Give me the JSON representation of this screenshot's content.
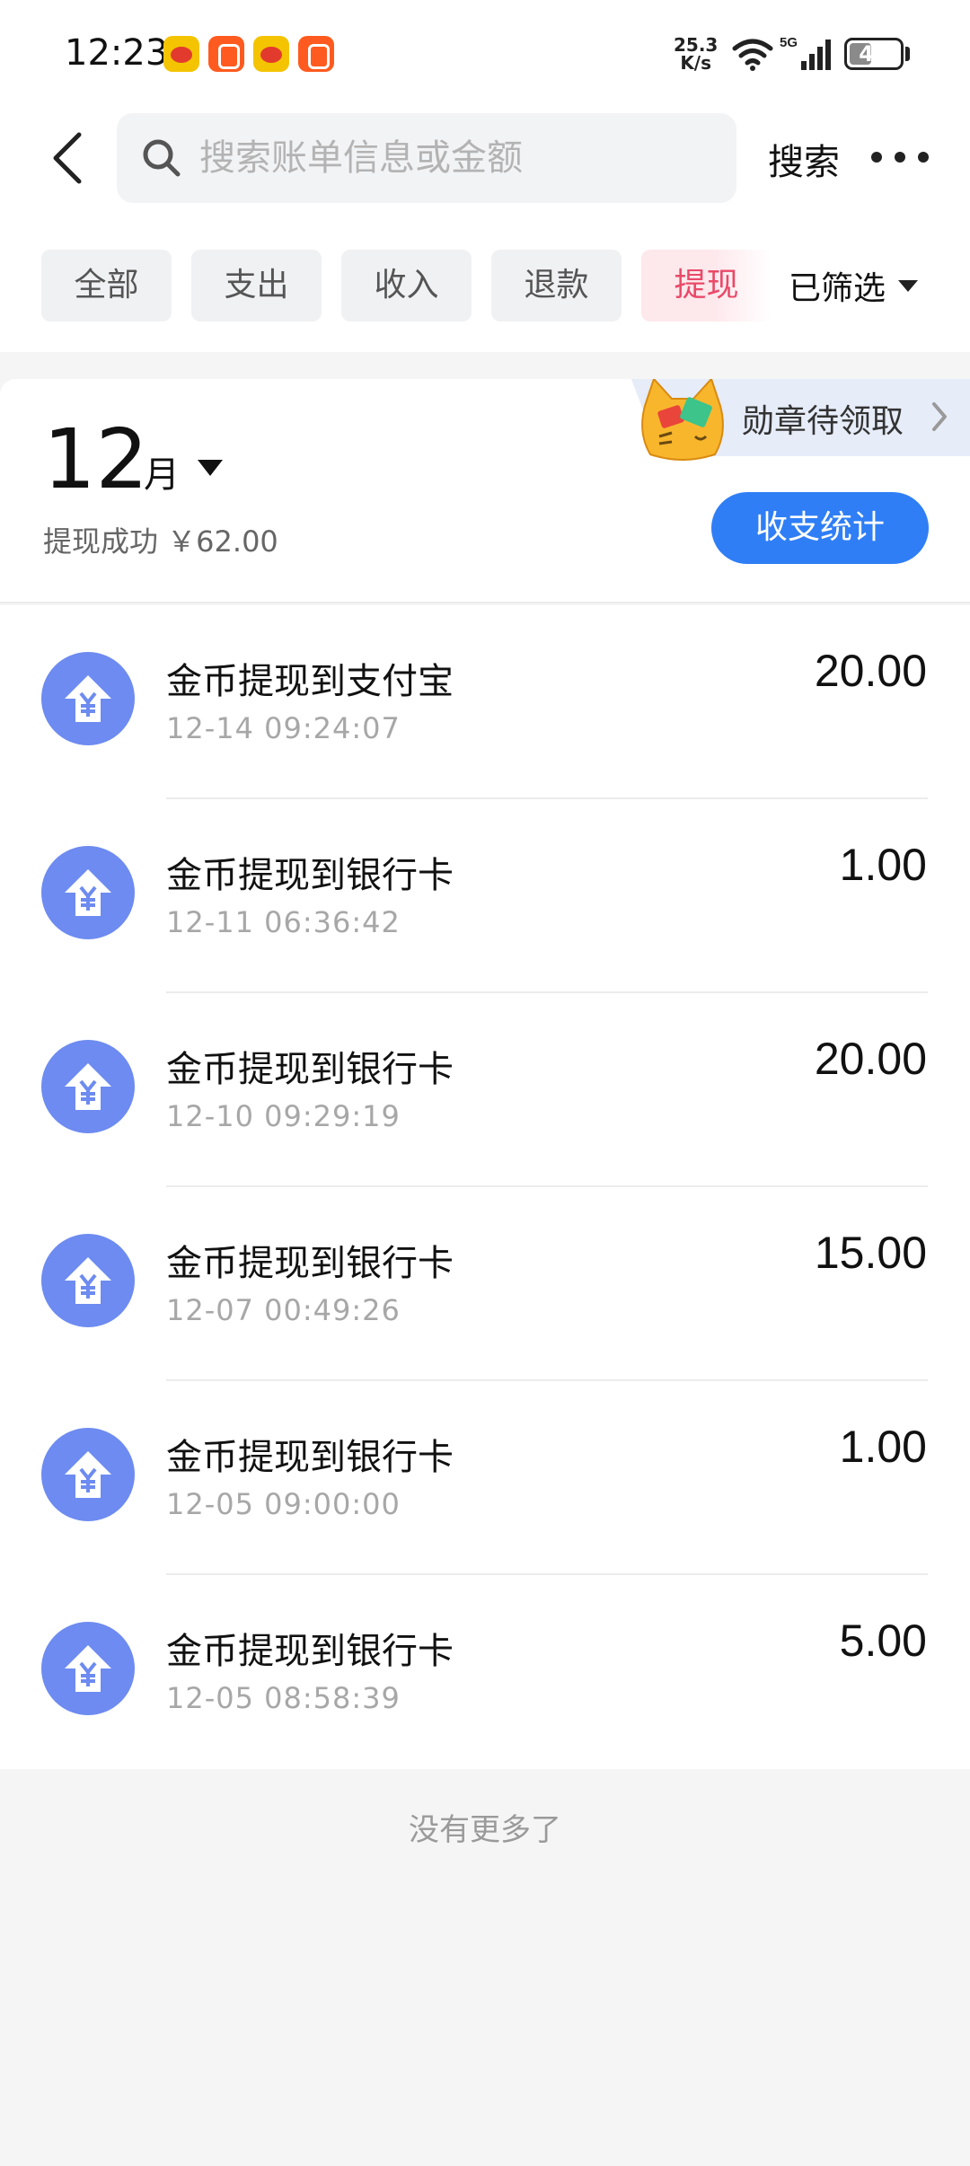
{
  "status_bar": {
    "time": "12:23",
    "net_speed_value": "25.3",
    "net_speed_unit": "K/s",
    "network": "5G",
    "battery_level": "44",
    "battery_fraction": 0.44
  },
  "search": {
    "placeholder": "搜索账单信息或金额",
    "button_label": "搜索"
  },
  "filters": {
    "tabs": [
      {
        "label": "全部"
      },
      {
        "label": "支出"
      },
      {
        "label": "收入"
      },
      {
        "label": "退款"
      },
      {
        "label": "提现",
        "active": true
      }
    ],
    "toggle_label": "已筛选"
  },
  "badge": {
    "label": "勋章待领取"
  },
  "month": {
    "number": "12",
    "unit": "月",
    "summary": "提现成功 ￥62.00",
    "stats_button": "收支统计"
  },
  "transactions": [
    {
      "title": "金币提现到支付宝",
      "time": "12-14 09:24:07",
      "amount": "20.00"
    },
    {
      "title": "金币提现到银行卡",
      "time": "12-11 06:36:42",
      "amount": "1.00"
    },
    {
      "title": "金币提现到银行卡",
      "time": "12-10 09:29:19",
      "amount": "20.00"
    },
    {
      "title": "金币提现到银行卡",
      "time": "12-07 00:49:26",
      "amount": "15.00"
    },
    {
      "title": "金币提现到银行卡",
      "time": "12-05 09:00:00",
      "amount": "1.00"
    },
    {
      "title": "金币提现到银行卡",
      "time": "12-05 08:58:39",
      "amount": "5.00"
    }
  ],
  "footer": {
    "no_more": "没有更多了"
  },
  "colors": {
    "accent": "#2f7ef5",
    "icon_bg": "#6d8bf0",
    "active_tab_text": "#e94968"
  }
}
